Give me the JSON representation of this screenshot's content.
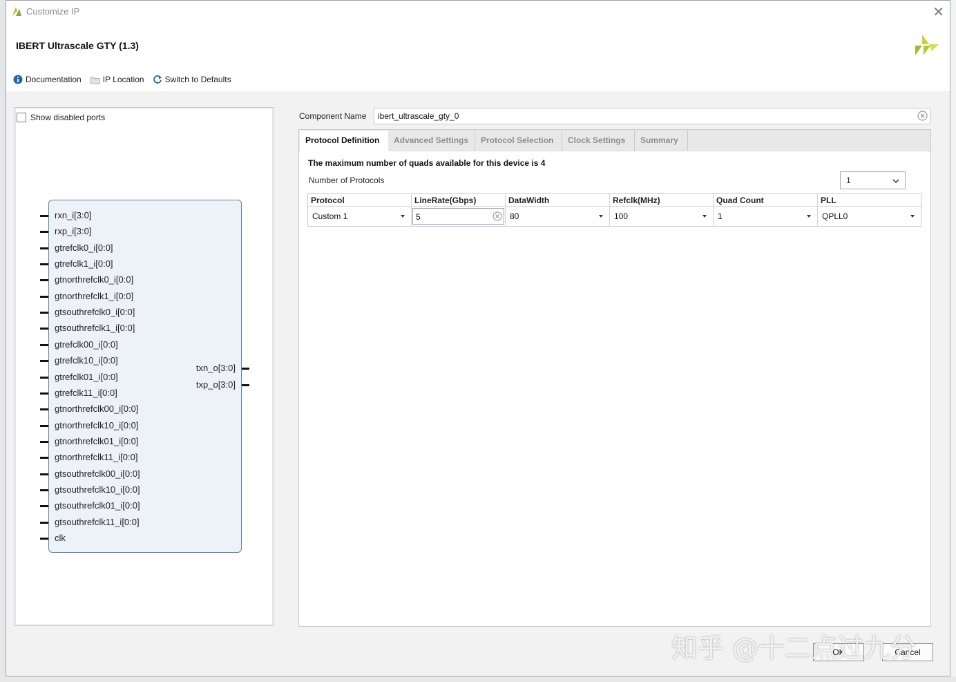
{
  "window": {
    "title": "Customize IP",
    "ip_title": "IBERT Ultrascale GTY (1.3)"
  },
  "toolbar": {
    "documentation": "Documentation",
    "ip_location": "IP Location",
    "switch_defaults": "Switch to Defaults"
  },
  "left_panel": {
    "show_disabled_ports": "Show disabled ports",
    "show_disabled_checked": false,
    "input_ports": [
      "rxn_i[3:0]",
      "rxp_i[3:0]",
      "gtrefclk0_i[0:0]",
      "gtrefclk1_i[0:0]",
      "gtnorthrefclk0_i[0:0]",
      "gtnorthrefclk1_i[0:0]",
      "gtsouthrefclk0_i[0:0]",
      "gtsouthrefclk1_i[0:0]",
      "gtrefclk00_i[0:0]",
      "gtrefclk10_i[0:0]",
      "gtrefclk01_i[0:0]",
      "gtrefclk11_i[0:0]",
      "gtnorthrefclk00_i[0:0]",
      "gtnorthrefclk10_i[0:0]",
      "gtnorthrefclk01_i[0:0]",
      "gtnorthrefclk11_i[0:0]",
      "gtsouthrefclk00_i[0:0]",
      "gtsouthrefclk10_i[0:0]",
      "gtsouthrefclk01_i[0:0]",
      "gtsouthrefclk11_i[0:0]",
      "clk"
    ],
    "output_ports": [
      "txn_o[3:0]",
      "txp_o[3:0]"
    ]
  },
  "component": {
    "label": "Component Name",
    "value": "ibert_ultrascale_gty_0"
  },
  "tabs": [
    {
      "label": "Protocol Definition",
      "active": true
    },
    {
      "label": "Advanced Settings",
      "active": false
    },
    {
      "label": "Protocol Selection",
      "active": false
    },
    {
      "label": "Clock Settings",
      "active": false
    },
    {
      "label": "Summary",
      "active": false
    }
  ],
  "protocol_definition": {
    "max_quads_text": "The maximum number of quads available for this device is 4",
    "num_protocols_label": "Number of Protocols",
    "num_protocols_value": "1",
    "table": {
      "headers": [
        "Protocol",
        "LineRate(Gbps)",
        "DataWidth",
        "Refclk(MHz)",
        "Quad Count",
        "PLL"
      ],
      "row": [
        "Custom 1",
        "5",
        "80",
        "100",
        "1",
        "QPLL0"
      ]
    }
  },
  "buttons": {
    "ok": "OK",
    "cancel": "Cancel"
  },
  "watermark": "知乎 @十二点过九分",
  "colors": {
    "symbol_fill": "#edf2f8",
    "symbol_border": "#5f7fa8",
    "xilinx_logo": "#c9d43a",
    "info_icon": "#2a62a8"
  }
}
